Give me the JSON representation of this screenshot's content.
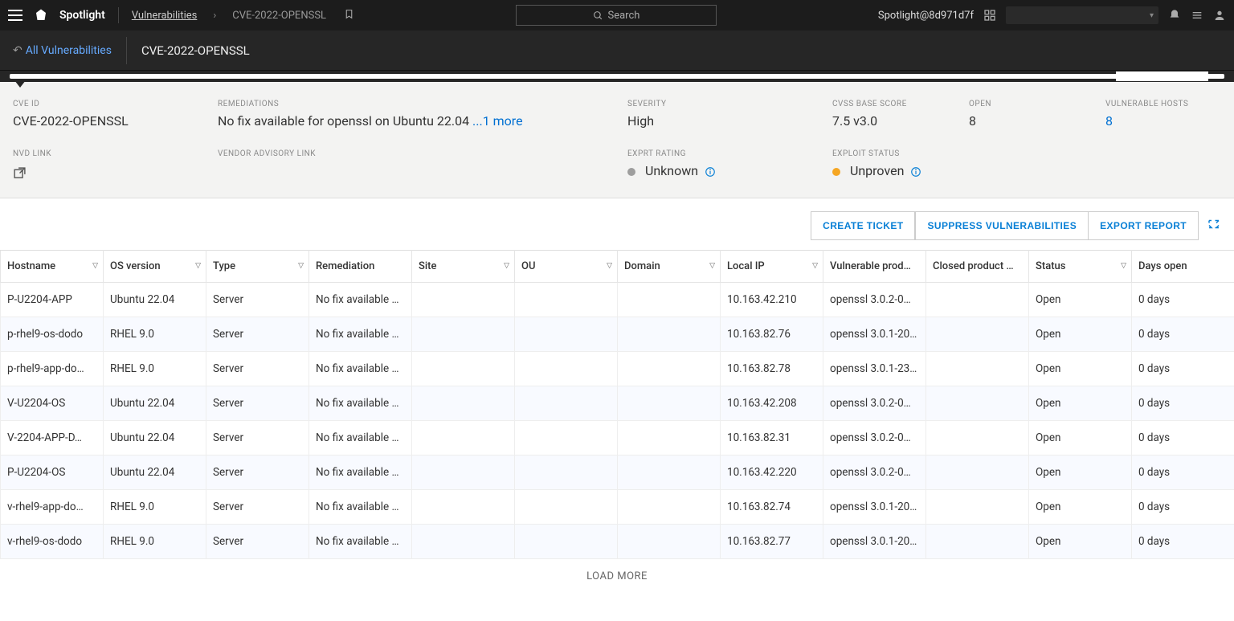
{
  "topbar": {
    "app_name": "Spotlight",
    "breadcrumb_parent": "Vulnerabilities",
    "breadcrumb_current": "CVE-2022-OPENSSL",
    "search_placeholder": "Search",
    "tenant": "Spotlight@8d971d7f"
  },
  "subtop": {
    "back_label": "All Vulnerabilities",
    "title": "CVE-2022-OPENSSL"
  },
  "details": {
    "cve_id_label": "CVE ID",
    "cve_id": "CVE-2022-OPENSSL",
    "remediations_label": "REMEDIATIONS",
    "remediations": "No fix available for openssl on Ubuntu 22.04 ",
    "remediations_more": "...1 more",
    "severity_label": "SEVERITY",
    "severity": "High",
    "cvss_label": "CVSS BASE SCORE",
    "cvss": "7.5 v3.0",
    "open_label": "OPEN",
    "open": "8",
    "vuln_hosts_label": "VULNERABLE HOSTS",
    "vuln_hosts": "8",
    "nvd_link_label": "NVD LINK",
    "vendor_adv_label": "VENDOR ADVISORY LINK",
    "exprt_label": "EXPRT RATING",
    "exprt": "Unknown",
    "exploit_label": "EXPLOIT STATUS",
    "exploit": "Unproven"
  },
  "actions": {
    "create_ticket": "CREATE TICKET",
    "suppress": "SUPPRESS VULNERABILITIES",
    "export": "EXPORT REPORT"
  },
  "table": {
    "headers": {
      "hostname": "Hostname",
      "os": "OS version",
      "type": "Type",
      "remediation": "Remediation",
      "site": "Site",
      "ou": "OU",
      "domain": "Domain",
      "local_ip": "Local IP",
      "vuln_prod": "Vulnerable prod…",
      "closed_prod": "Closed product …",
      "status": "Status",
      "days_open": "Days open"
    },
    "rows": [
      {
        "hostname": "P-U2204-APP",
        "os": "Ubuntu 22.04",
        "type": "Server",
        "remediation": "No fix available …",
        "site": "",
        "ou": "",
        "domain": "",
        "local_ip": "10.163.42.210",
        "vuln_prod": "openssl 3.0.2-0…",
        "closed_prod": "",
        "status": "Open",
        "days_open": "0 days"
      },
      {
        "hostname": "p-rhel9-os-dodo",
        "os": "RHEL 9.0",
        "type": "Server",
        "remediation": "No fix available …",
        "site": "",
        "ou": "",
        "domain": "",
        "local_ip": "10.163.82.76",
        "vuln_prod": "openssl 3.0.1-20…",
        "closed_prod": "",
        "status": "Open",
        "days_open": "0 days"
      },
      {
        "hostname": "p-rhel9-app-do…",
        "os": "RHEL 9.0",
        "type": "Server",
        "remediation": "No fix available …",
        "site": "",
        "ou": "",
        "domain": "",
        "local_ip": "10.163.82.78",
        "vuln_prod": "openssl 3.0.1-23…",
        "closed_prod": "",
        "status": "Open",
        "days_open": "0 days"
      },
      {
        "hostname": "V-U2204-OS",
        "os": "Ubuntu 22.04",
        "type": "Server",
        "remediation": "No fix available …",
        "site": "",
        "ou": "",
        "domain": "",
        "local_ip": "10.163.42.208",
        "vuln_prod": "openssl 3.0.2-0…",
        "closed_prod": "",
        "status": "Open",
        "days_open": "0 days"
      },
      {
        "hostname": "V-2204-APP-D…",
        "os": "Ubuntu 22.04",
        "type": "Server",
        "remediation": "No fix available …",
        "site": "",
        "ou": "",
        "domain": "",
        "local_ip": "10.163.82.31",
        "vuln_prod": "openssl 3.0.2-0…",
        "closed_prod": "",
        "status": "Open",
        "days_open": "0 days"
      },
      {
        "hostname": "P-U2204-OS",
        "os": "Ubuntu 22.04",
        "type": "Server",
        "remediation": "No fix available …",
        "site": "",
        "ou": "",
        "domain": "",
        "local_ip": "10.163.42.220",
        "vuln_prod": "openssl 3.0.2-0…",
        "closed_prod": "",
        "status": "Open",
        "days_open": "0 days"
      },
      {
        "hostname": "v-rhel9-app-do…",
        "os": "RHEL 9.0",
        "type": "Server",
        "remediation": "No fix available …",
        "site": "",
        "ou": "",
        "domain": "",
        "local_ip": "10.163.82.74",
        "vuln_prod": "openssl 3.0.1-20…",
        "closed_prod": "",
        "status": "Open",
        "days_open": "0 days"
      },
      {
        "hostname": "v-rhel9-os-dodo",
        "os": "RHEL 9.0",
        "type": "Server",
        "remediation": "No fix available …",
        "site": "",
        "ou": "",
        "domain": "",
        "local_ip": "10.163.82.77",
        "vuln_prod": "openssl 3.0.1-20…",
        "closed_prod": "",
        "status": "Open",
        "days_open": "0 days"
      }
    ],
    "load_more": "LOAD MORE"
  }
}
